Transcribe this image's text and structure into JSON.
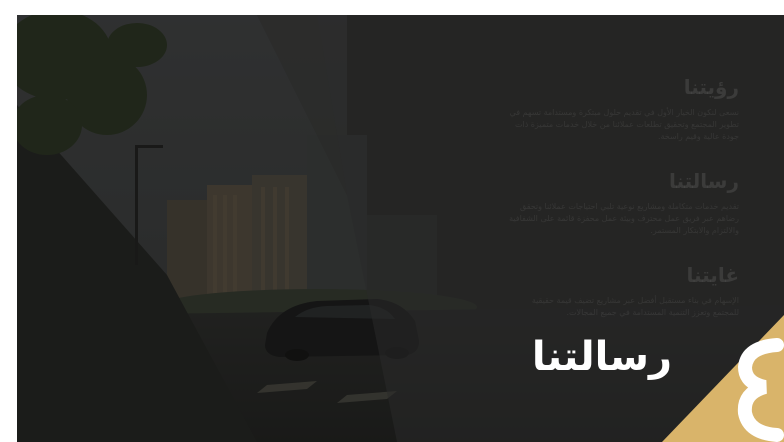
{
  "slide": {
    "title": "رسالتنا",
    "accent_color": "#d9b46a"
  },
  "sections": [
    {
      "heading": "رؤيتنا",
      "body": "نسعى لنكون الخيار الأول في تقديم حلول مبتكرة ومستدامة تسهم في تطوير المجتمع وتحقيق تطلعات عملائنا من خلال خدمات متميزة ذات جودة عالية وقيم راسخة."
    },
    {
      "heading": "رسالتنا",
      "body": "تقديم خدمات متكاملة ومشاريع نوعية تلبي احتياجات عملائنا وتحقق رضاهم عبر فريق عمل محترف وبيئة عمل محفزة قائمة على الشفافية والالتزام والابتكار المستمر."
    },
    {
      "heading": "غايتنا",
      "body": "الإسهام في بناء مستقبل أفضل عبر مشاريع تضيف قيمة حقيقية للمجتمع وتعزز التنمية المستدامة في جميع المجالات."
    }
  ]
}
